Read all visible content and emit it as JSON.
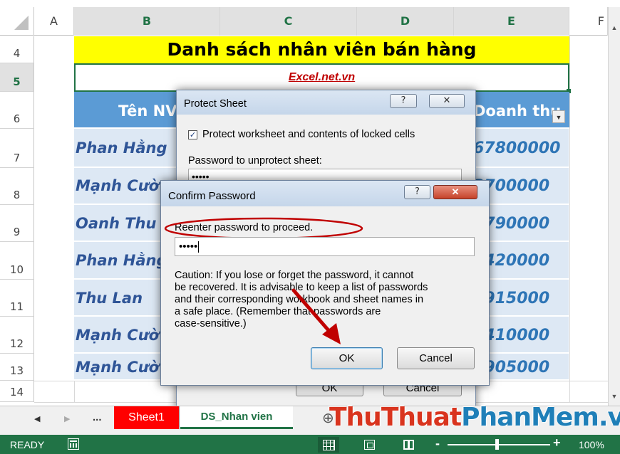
{
  "grid": {
    "columns": [
      "A",
      "B",
      "C",
      "D",
      "E",
      "F"
    ],
    "rows": [
      "4",
      "5",
      "6",
      "7",
      "8",
      "9",
      "10",
      "11",
      "12",
      "13",
      "14"
    ],
    "title": "Danh sách nhân viên bán hàng",
    "subtitle": "Excel.net.vn",
    "header_name": "Tên NV",
    "header_revenue": "Doanh thu",
    "names": [
      "Phan Hằng",
      "Mạnh Cườ",
      "Oanh Thu",
      "Phan Hằng",
      "Thu Lan",
      "Mạnh Cườ",
      "Mạnh Cườ"
    ],
    "values": [
      "67800000",
      "3700000",
      "3790000",
      "1420000",
      "3915000",
      "2410000",
      "3905000"
    ]
  },
  "protect_dialog": {
    "title": "Protect Sheet",
    "help_label": "?",
    "close_label": "✕",
    "checkbox_label": "Protect worksheet and contents of locked cells",
    "checkbox_checked": true,
    "password_label": "Password to unprotect sheet:",
    "password_value": "•••••",
    "ok_label": "OK",
    "cancel_label": "Cancel"
  },
  "confirm_dialog": {
    "title": "Confirm Password",
    "help_label": "?",
    "close_label": "✕",
    "prompt": "Reenter password to proceed.",
    "password_value": "•••••",
    "caution_lines": [
      "Caution: If you lose or forget the password, it cannot",
      "be recovered. It is advisable to keep a list of passwords",
      "and their corresponding workbook and sheet names in",
      "a safe place.  (Remember that passwords are",
      "case-sensitive.)"
    ],
    "ok_label": "OK",
    "cancel_label": "Cancel"
  },
  "tabs": {
    "ellipsis": "...",
    "sheet1": "Sheet1",
    "ds_nhan_vien": "DS_Nhan vien",
    "add": "⊕"
  },
  "status": {
    "ready": "READY",
    "zoom": "100%",
    "minus": "-",
    "plus": "+"
  },
  "watermark": {
    "part1": "Thu",
    "part2": "Thuat",
    "part3": "PhanMem",
    "part4": ".vn"
  },
  "colors": {
    "title_bg": "#ffff00",
    "header_bg": "#5b9bd5",
    "row_bg": "#dde8f4",
    "status_bg": "#217346",
    "sheet1_bg": "#ff0000",
    "annotation_red": "#c00000"
  }
}
